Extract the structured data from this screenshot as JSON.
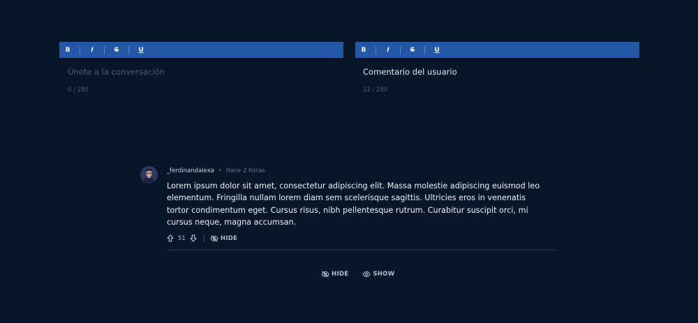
{
  "toolbar": {
    "bold": "B",
    "italic": "I",
    "strike": "S",
    "underline": "U"
  },
  "editor_left": {
    "placeholder": "Únete a la conversación",
    "counter": "0 / 280"
  },
  "editor_right": {
    "value": "Comentario del usuario",
    "counter": "22 / 280"
  },
  "comment": {
    "username": "_ferdinandalexa",
    "separator": "•",
    "time": "Hace 2 horas",
    "text": "Lorem ipsum dolor sit amet, consectetur adipiscing elit. Massa molestie adipiscing euismod leo elementum. Fringilla nullam lorem diam sem scelerisque sagittis. Ultricies eros in venenatis tortor condimentum eget. Cursus risus, nibh pellentesque rutrum. Curabitur suscipit orci, mi cursus neque, magna accumsan.",
    "votes": "51",
    "hide_label": "HIDE"
  },
  "bottom": {
    "hide_label": "HIDE",
    "show_label": "SHOW"
  },
  "colors": {
    "background": "#081629",
    "toolbar": "#2458a6"
  }
}
